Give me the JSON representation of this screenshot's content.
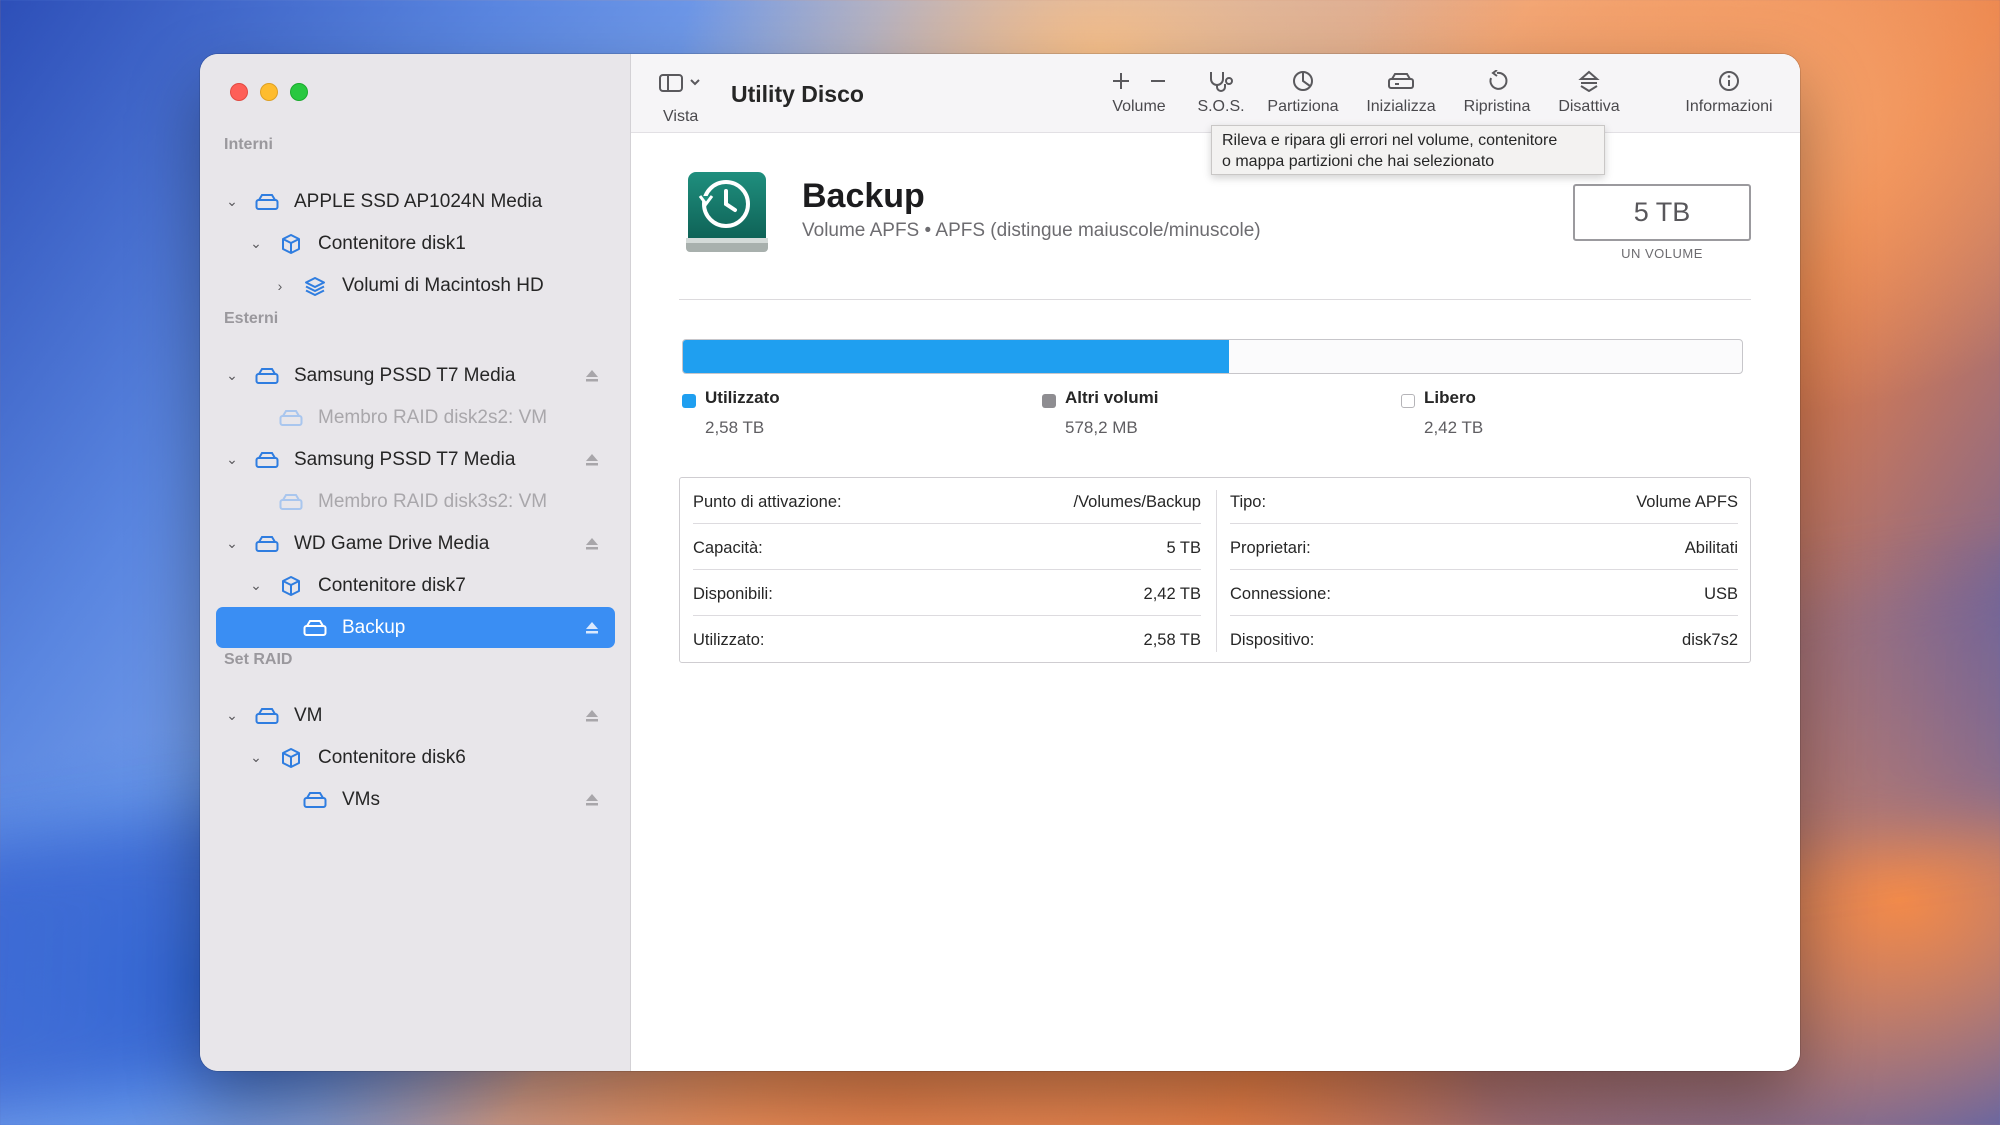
{
  "window": {
    "title": "Utility Disco"
  },
  "sidebar": {
    "sections": {
      "interni": "Interni",
      "esterni": "Esterni",
      "raid": "Set RAID"
    },
    "items": [
      {
        "label": "APPLE SSD AP1024N Media",
        "icon": "drive-icon",
        "state": "expanded"
      },
      {
        "label": "Contenitore disk1",
        "icon": "container-icon",
        "state": "expanded"
      },
      {
        "label": "Volumi di Macintosh HD",
        "icon": "layers-icon",
        "state": "collapsed"
      },
      {
        "label": "Samsung PSSD T7 Media",
        "icon": "drive-icon",
        "state": "expanded",
        "eject": true
      },
      {
        "label": "Membro RAID disk2s2: VM",
        "icon": "drive-icon",
        "disabled": true
      },
      {
        "label": "Samsung PSSD T7 Media",
        "icon": "drive-icon",
        "state": "expanded",
        "eject": true
      },
      {
        "label": "Membro RAID disk3s2: VM",
        "icon": "drive-icon",
        "disabled": true
      },
      {
        "label": "WD Game Drive Media",
        "icon": "drive-icon",
        "state": "expanded",
        "eject": true
      },
      {
        "label": "Contenitore disk7",
        "icon": "container-icon",
        "state": "expanded"
      },
      {
        "label": "Backup",
        "icon": "volume-icon",
        "selected": true,
        "eject": true
      },
      {
        "label": "VM",
        "icon": "drive-icon",
        "state": "expanded",
        "eject": true
      },
      {
        "label": "Contenitore disk6",
        "icon": "container-icon",
        "state": "expanded"
      },
      {
        "label": "VMs",
        "icon": "volume-icon",
        "eject": true
      }
    ]
  },
  "toolbar": {
    "vista": "Vista",
    "volume": "Volume",
    "sos": "S.O.S.",
    "partiziona": "Partiziona",
    "inizializza": "Inizializza",
    "ripristina": "Ripristina",
    "disattiva": "Disattiva",
    "informazioni": "Informazioni"
  },
  "tooltip": {
    "line1": "Rileva e ripara gli errori nel volume, contenitore",
    "line2": "o mappa partizioni che hai selezionato"
  },
  "volume": {
    "name": "Backup",
    "subtitle": "Volume APFS • APFS (distingue maiuscole/minuscole)",
    "size": "5 TB",
    "size_caption": "UN VOLUME"
  },
  "usage": {
    "used_fraction": 0.516,
    "legend": [
      {
        "name": "Utilizzato",
        "value": "2,58 TB",
        "color": "#1f9ff0"
      },
      {
        "name": "Altri volumi",
        "value": "578,2 MB",
        "color": "#8e8d91"
      },
      {
        "name": "Libero",
        "value": "2,42 TB",
        "color": "#ffffff"
      }
    ]
  },
  "info": {
    "left": [
      {
        "key": "Punto di attivazione:",
        "value": "/Volumes/Backup"
      },
      {
        "key": "Capacità:",
        "value": "5 TB"
      },
      {
        "key": "Disponibili:",
        "value": "2,42 TB"
      },
      {
        "key": "Utilizzato:",
        "value": "2,58 TB"
      }
    ],
    "right": [
      {
        "key": "Tipo:",
        "value": "Volume APFS"
      },
      {
        "key": "Proprietari:",
        "value": "Abilitati"
      },
      {
        "key": "Connessione:",
        "value": "USB"
      },
      {
        "key": "Dispositivo:",
        "value": "disk7s2"
      }
    ]
  }
}
